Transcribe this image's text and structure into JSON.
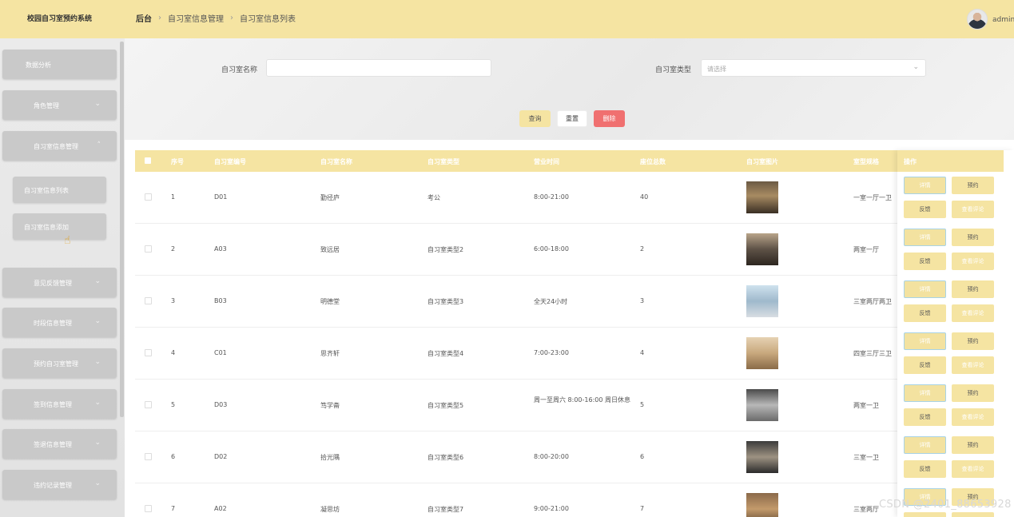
{
  "app_title": "校园自习室预约系统",
  "breadcrumb": [
    "后台",
    "自习室信息管理",
    "自习室信息列表"
  ],
  "user": {
    "name": "admin"
  },
  "sidebar": {
    "items": [
      {
        "label": "数据分析"
      },
      {
        "label": "角色管理"
      },
      {
        "label": "自习室信息管理"
      },
      {
        "label": "意见反馈管理"
      },
      {
        "label": "时段信息管理"
      },
      {
        "label": "预约自习室管理"
      },
      {
        "label": "签到信息管理"
      },
      {
        "label": "签退信息管理"
      },
      {
        "label": "违约记录管理"
      }
    ],
    "sub_items": [
      {
        "label": "自习室信息列表"
      },
      {
        "label": "自习室信息添加"
      }
    ]
  },
  "search": {
    "name_label": "自习室名称",
    "name_value": "",
    "type_label": "自习室类型",
    "type_placeholder": "请选择",
    "query_button": "查询",
    "reset_button": "重置",
    "delete_button": "删除"
  },
  "table": {
    "headers": [
      "序号",
      "自习室编号",
      "自习室名称",
      "自习室类型",
      "营业时间",
      "座位总数",
      "自习室图片",
      "室型规格",
      "操作"
    ],
    "rows": [
      {
        "index": "1",
        "code": "D01",
        "name": "勤径庐",
        "type": "考公",
        "hours": "8:00-21:00",
        "seats": "40",
        "spec": "一室一厅一卫"
      },
      {
        "index": "2",
        "code": "A03",
        "name": "致远居",
        "type": "自习室类型2",
        "hours": "6:00-18:00",
        "seats": "2",
        "spec": "两室一厅"
      },
      {
        "index": "3",
        "code": "B03",
        "name": "明德堂",
        "type": "自习室类型3",
        "hours": "全天24小时",
        "seats": "3",
        "spec": "三室两厅两卫"
      },
      {
        "index": "4",
        "code": "C01",
        "name": "思齐轩",
        "type": "自习室类型4",
        "hours": "7:00-23:00",
        "seats": "4",
        "spec": "四室三厅三卫"
      },
      {
        "index": "5",
        "code": "D03",
        "name": "笃学斋",
        "type": "自习室类型5",
        "hours": "周一至周六 8:00-16:00 周日休息",
        "seats": "5",
        "spec": "两室一卫"
      },
      {
        "index": "6",
        "code": "D02",
        "name": "拾光隅",
        "type": "自习室类型6",
        "hours": "8:00-20:00",
        "seats": "6",
        "spec": "三室一卫"
      },
      {
        "index": "7",
        "code": "A02",
        "name": "凝思坊",
        "type": "自习室类型7",
        "hours": "9:00-21:00",
        "seats": "7",
        "spec": "三室两厅"
      }
    ],
    "actions": {
      "detail": "详情",
      "book": "预约",
      "feedback": "反馈",
      "review": "查看评论"
    }
  },
  "watermark": "CSDN @2401_88653928",
  "colors": {
    "header_bg": "#f5e4a2",
    "menu_bg": "#c9c9c9",
    "delete_red": "#f07070"
  }
}
